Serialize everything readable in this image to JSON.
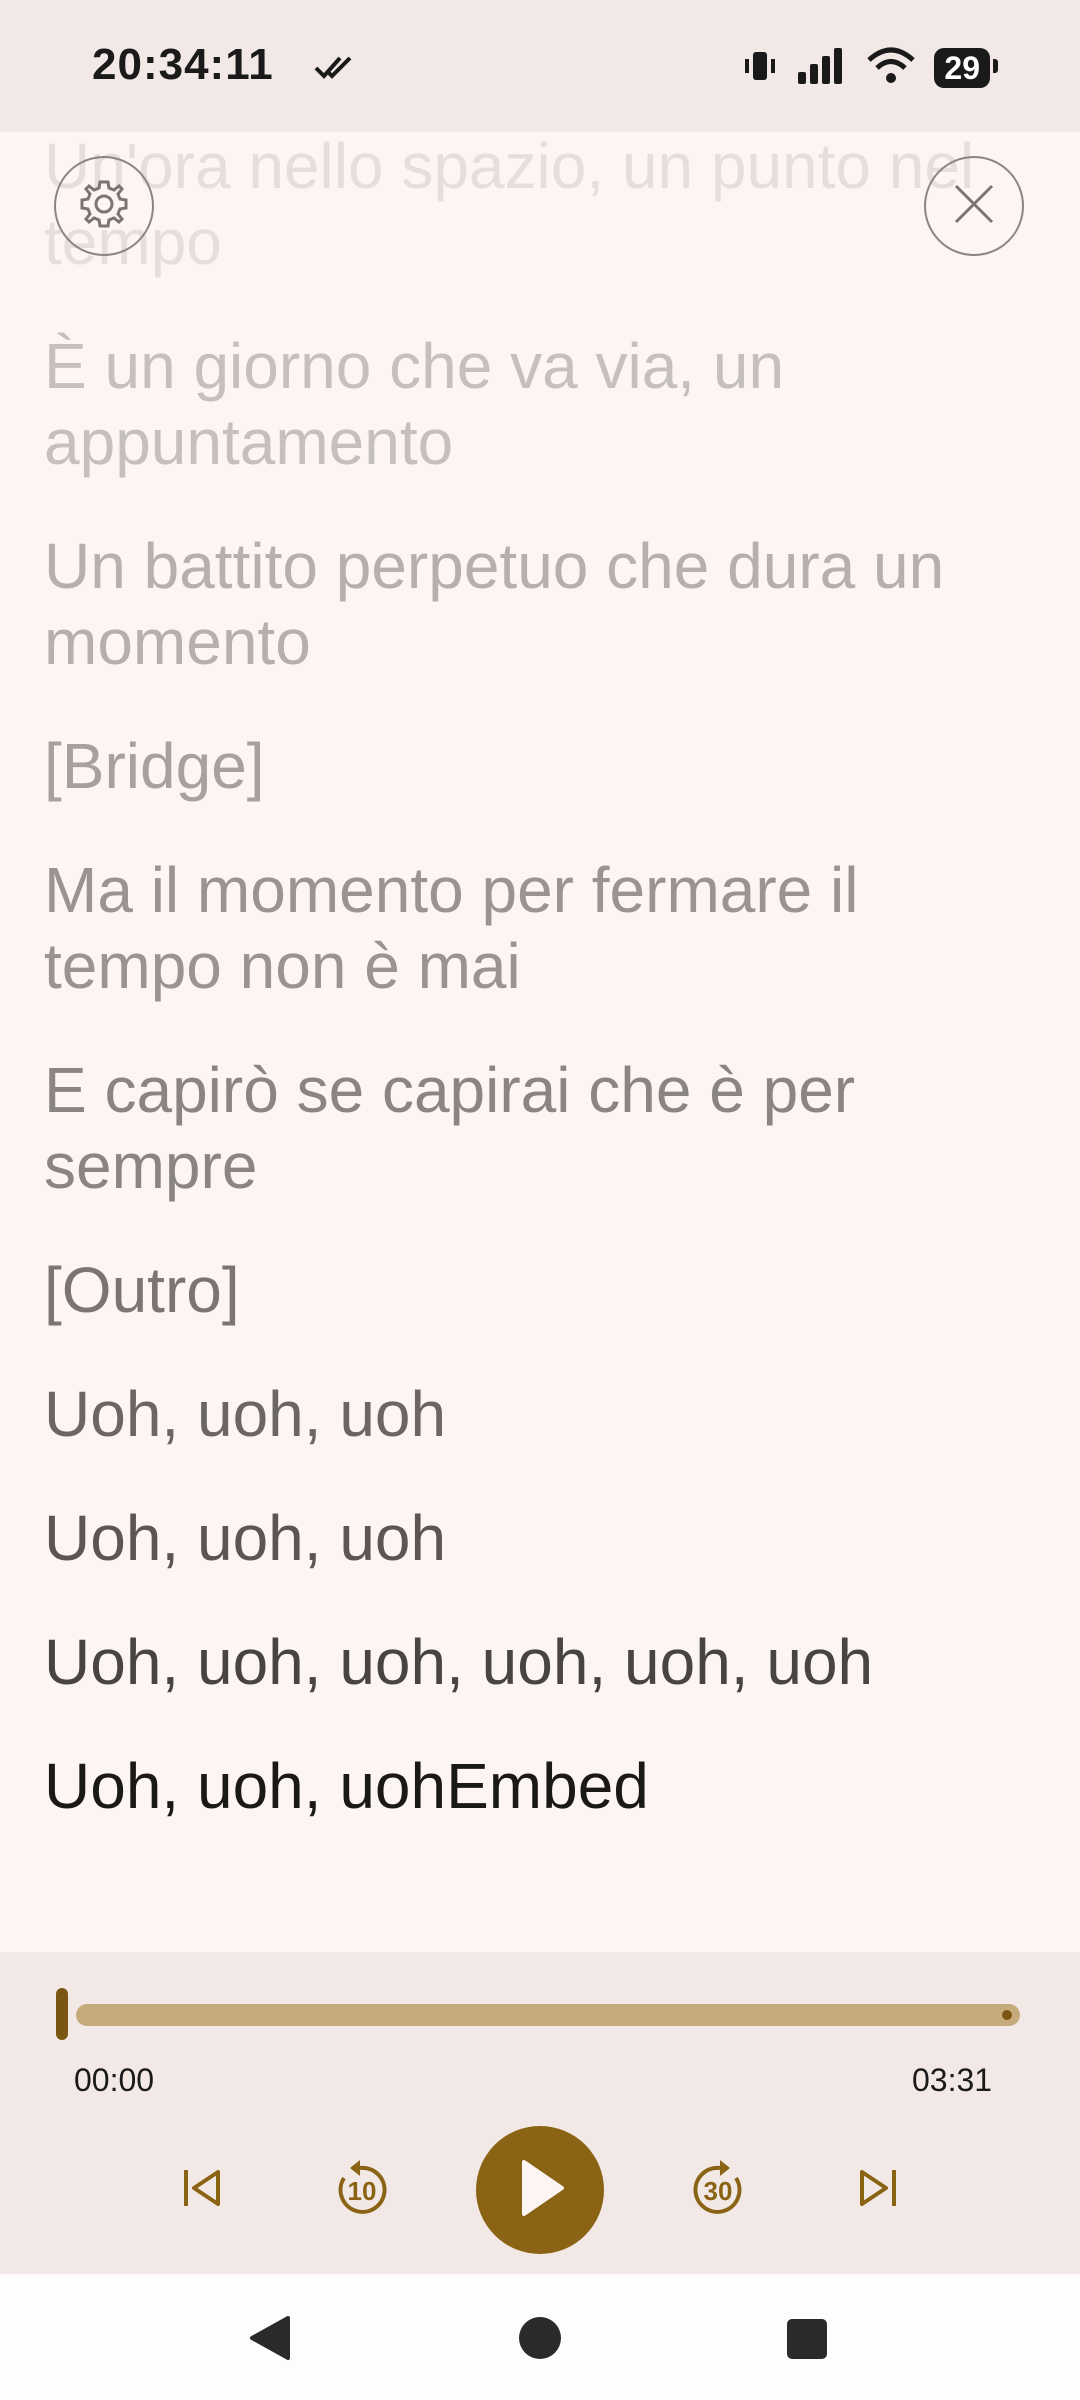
{
  "status_bar": {
    "time": "20:34:11",
    "battery_level": "29",
    "icons": [
      "double-check-icon",
      "vibrate-icon",
      "signal-icon",
      "wifi-icon",
      "battery-icon"
    ]
  },
  "lyrics": {
    "lines": [
      {
        "text": "Un'ora nello spazio, un punto nel tempo",
        "color": "#e7dedb"
      },
      {
        "text": "È un giorno che va via, un appuntamento",
        "color": "#c6c0bd"
      },
      {
        "text": "Un battito perpetuo che dura un momento",
        "color": "#b6afab"
      },
      {
        "text": "[Bridge]",
        "color": "#a7a09c"
      },
      {
        "text": "Ma il momento per fermare il tempo non è mai",
        "color": "#9a9390"
      },
      {
        "text": "E capirò se capirai che è per sempre",
        "color": "#8b8582"
      },
      {
        "text": "[Outro]",
        "color": "#7b7572"
      },
      {
        "text": "Uoh, uoh, uoh",
        "color": "#6b6664"
      },
      {
        "text": "Uoh, uoh, uoh",
        "color": "#5b5654"
      },
      {
        "text": "Uoh, uoh, uoh, uoh, uoh, uoh",
        "color": "#484442"
      },
      {
        "text": "Uoh, uoh, uohEmbed",
        "color": "#1b1918"
      }
    ]
  },
  "controls": {
    "settings_icon": "gear-icon",
    "close_icon": "close-icon"
  },
  "player": {
    "elapsed": "00:00",
    "duration": "03:31",
    "progress": 0,
    "accent_color": "#8a6414",
    "track_color": "#c5aa7c",
    "buttons": [
      "skip-previous-icon",
      "replay-10-icon",
      "play-icon",
      "forward-30-icon",
      "skip-next-icon"
    ],
    "replay_seconds": "10",
    "forward_seconds": "30"
  },
  "nav": {
    "buttons": [
      "back-icon",
      "home-icon",
      "recents-icon"
    ]
  }
}
